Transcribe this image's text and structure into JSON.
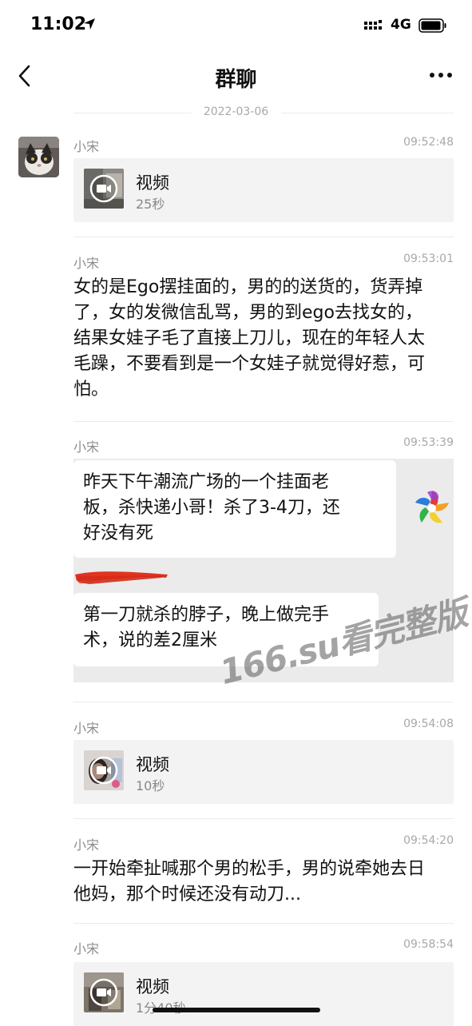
{
  "status_bar": {
    "time": "11:02",
    "network": "4G"
  },
  "nav": {
    "title": "群聊"
  },
  "date_separator": "2022-03-06",
  "messages": [
    {
      "sender": "小宋",
      "time": "09:52:48",
      "type": "video",
      "label": "视频",
      "duration": "25秒"
    },
    {
      "sender": "小宋",
      "time": "09:53:01",
      "type": "text",
      "lines": [
        "女的是Ego摆挂面的，男的的送货的，货弄掉",
        "了，女的发微信乱骂，男的到ego去找女的，",
        "结果女娃子毛了直接上刀儿，现在的年轻人太",
        "毛躁，不要看到是一个女娃子就觉得好惹，可",
        "怕。"
      ]
    },
    {
      "sender": "小宋",
      "time": "09:53:39",
      "type": "image",
      "bubble1": [
        "昨天下午潮流广场的一个挂面老",
        "板，杀快递小哥！杀了3-4刀，还",
        "好没有死"
      ],
      "bubble2": [
        "第一刀就杀的脖子，晚上做完手",
        "术，说的差2厘米"
      ]
    },
    {
      "sender": "小宋",
      "time": "09:54:08",
      "type": "video",
      "label": "视频",
      "duration": "10秒"
    },
    {
      "sender": "小宋",
      "time": "09:54:20",
      "type": "text",
      "lines": [
        "一开始牵扯喊那个男的松手，男的说牵她去日",
        "他妈，那个时候还没有动刀..."
      ]
    },
    {
      "sender": "小宋",
      "time": "09:58:54",
      "type": "video",
      "label": "视频",
      "duration": "1分40秒"
    }
  ],
  "watermark": "166.su看完整版",
  "colors": {
    "accent_red": "#e0341f",
    "meta_gray": "#a8a8a8",
    "card_bg": "#f3f3f3"
  }
}
